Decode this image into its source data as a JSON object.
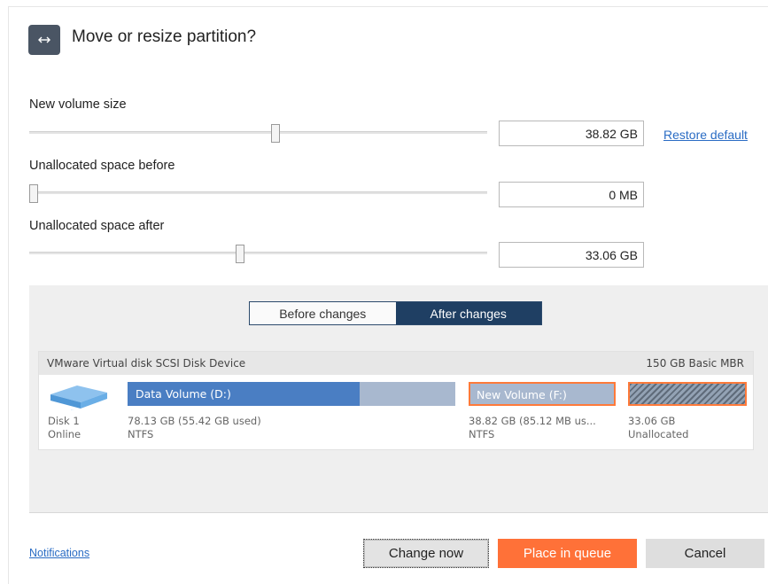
{
  "dialog": {
    "title": "Move or resize partition?",
    "title_icon": "resize-arrows-icon"
  },
  "sliders": {
    "new_volume_size": {
      "label": "New volume size",
      "value": "38.82 GB",
      "position": 0.539
    },
    "unallocated_before": {
      "label": "Unallocated space before",
      "value": "0 MB",
      "position": 0.0
    },
    "unallocated_after": {
      "label": "Unallocated space after",
      "value": "33.06 GB",
      "position": 0.459
    }
  },
  "restore_default": "Restore default",
  "view_toggle": {
    "before": "Before changes",
    "after": "After changes",
    "selected": "after"
  },
  "disk": {
    "device": "VMware Virtual disk SCSI Disk Device",
    "size_type": "150 GB Basic MBR",
    "disk_icon": "hard-disk-icon",
    "name": "Disk 1",
    "status": "Online",
    "partitions": [
      {
        "name": "Data Volume (D:)",
        "size_line": "78.13 GB (55.42 GB used)",
        "fs": "NTFS",
        "used_fraction": 0.709
      },
      {
        "name": "New Volume (F:)",
        "size_line": "38.82 GB (85.12 MB us...",
        "fs": "NTFS",
        "highlighted": true
      },
      {
        "name": "",
        "size_line": "33.06 GB",
        "fs": "Unallocated",
        "highlighted": true
      }
    ]
  },
  "footer": {
    "notifications": "Notifications",
    "change_now": "Change now",
    "place_in_queue": "Place in queue",
    "cancel": "Cancel"
  },
  "colors": {
    "accent": "#ff7138",
    "toggle_active": "#1f3f63",
    "used_bar": "#4a7ec3",
    "free_bar": "#a8b8cf",
    "link": "#2a6cc4"
  }
}
